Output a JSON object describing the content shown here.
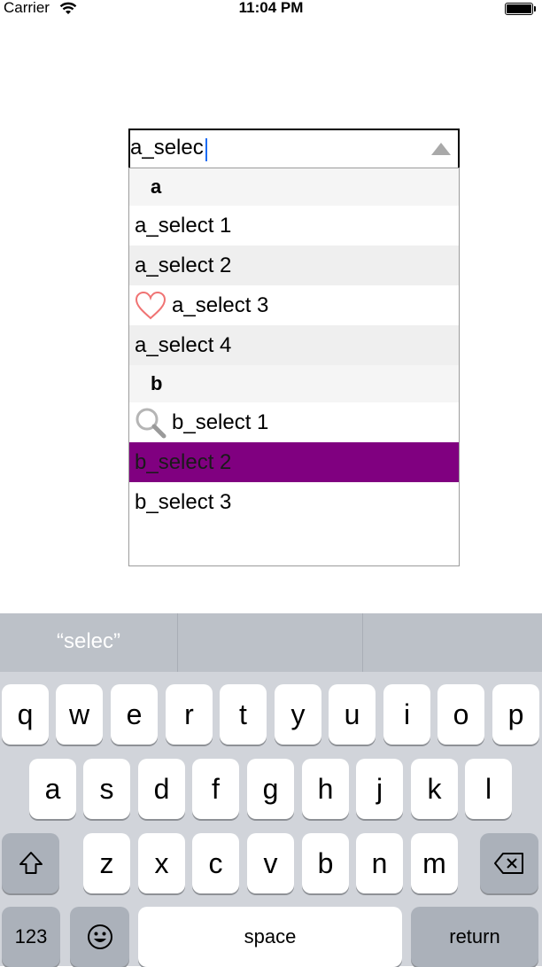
{
  "status_bar": {
    "carrier": "Carrier",
    "time": "11:04 PM"
  },
  "combo": {
    "value": "a_selec"
  },
  "dropdown": {
    "rows": [
      {
        "kind": "header",
        "label": "a"
      },
      {
        "kind": "item",
        "label": "a_select 1",
        "icon": null
      },
      {
        "kind": "item",
        "label": "a_select 2",
        "icon": null
      },
      {
        "kind": "item",
        "label": "a_select 3",
        "icon": "heart-icon"
      },
      {
        "kind": "item",
        "label": "a_select 4",
        "icon": null
      },
      {
        "kind": "header",
        "label": "b"
      },
      {
        "kind": "item",
        "label": "b_select 1",
        "icon": "magnifier-icon"
      },
      {
        "kind": "item",
        "label": "b_select 2",
        "icon": null,
        "selected": true
      },
      {
        "kind": "item",
        "label": "b_select 3",
        "icon": null
      }
    ],
    "selected_color": "#800080"
  },
  "keyboard": {
    "suggestions": [
      "“selec”",
      "",
      ""
    ],
    "row1": [
      "q",
      "w",
      "e",
      "r",
      "t",
      "y",
      "u",
      "i",
      "o",
      "p"
    ],
    "row2": [
      "a",
      "s",
      "d",
      "f",
      "g",
      "h",
      "j",
      "k",
      "l"
    ],
    "row3": [
      "z",
      "x",
      "c",
      "v",
      "b",
      "n",
      "m"
    ],
    "shift_icon": "shift-icon",
    "delete_icon": "backspace-icon",
    "numbers_label": "123",
    "emoji_icon": "emoji-icon",
    "space_label": "space",
    "return_label": "return"
  }
}
